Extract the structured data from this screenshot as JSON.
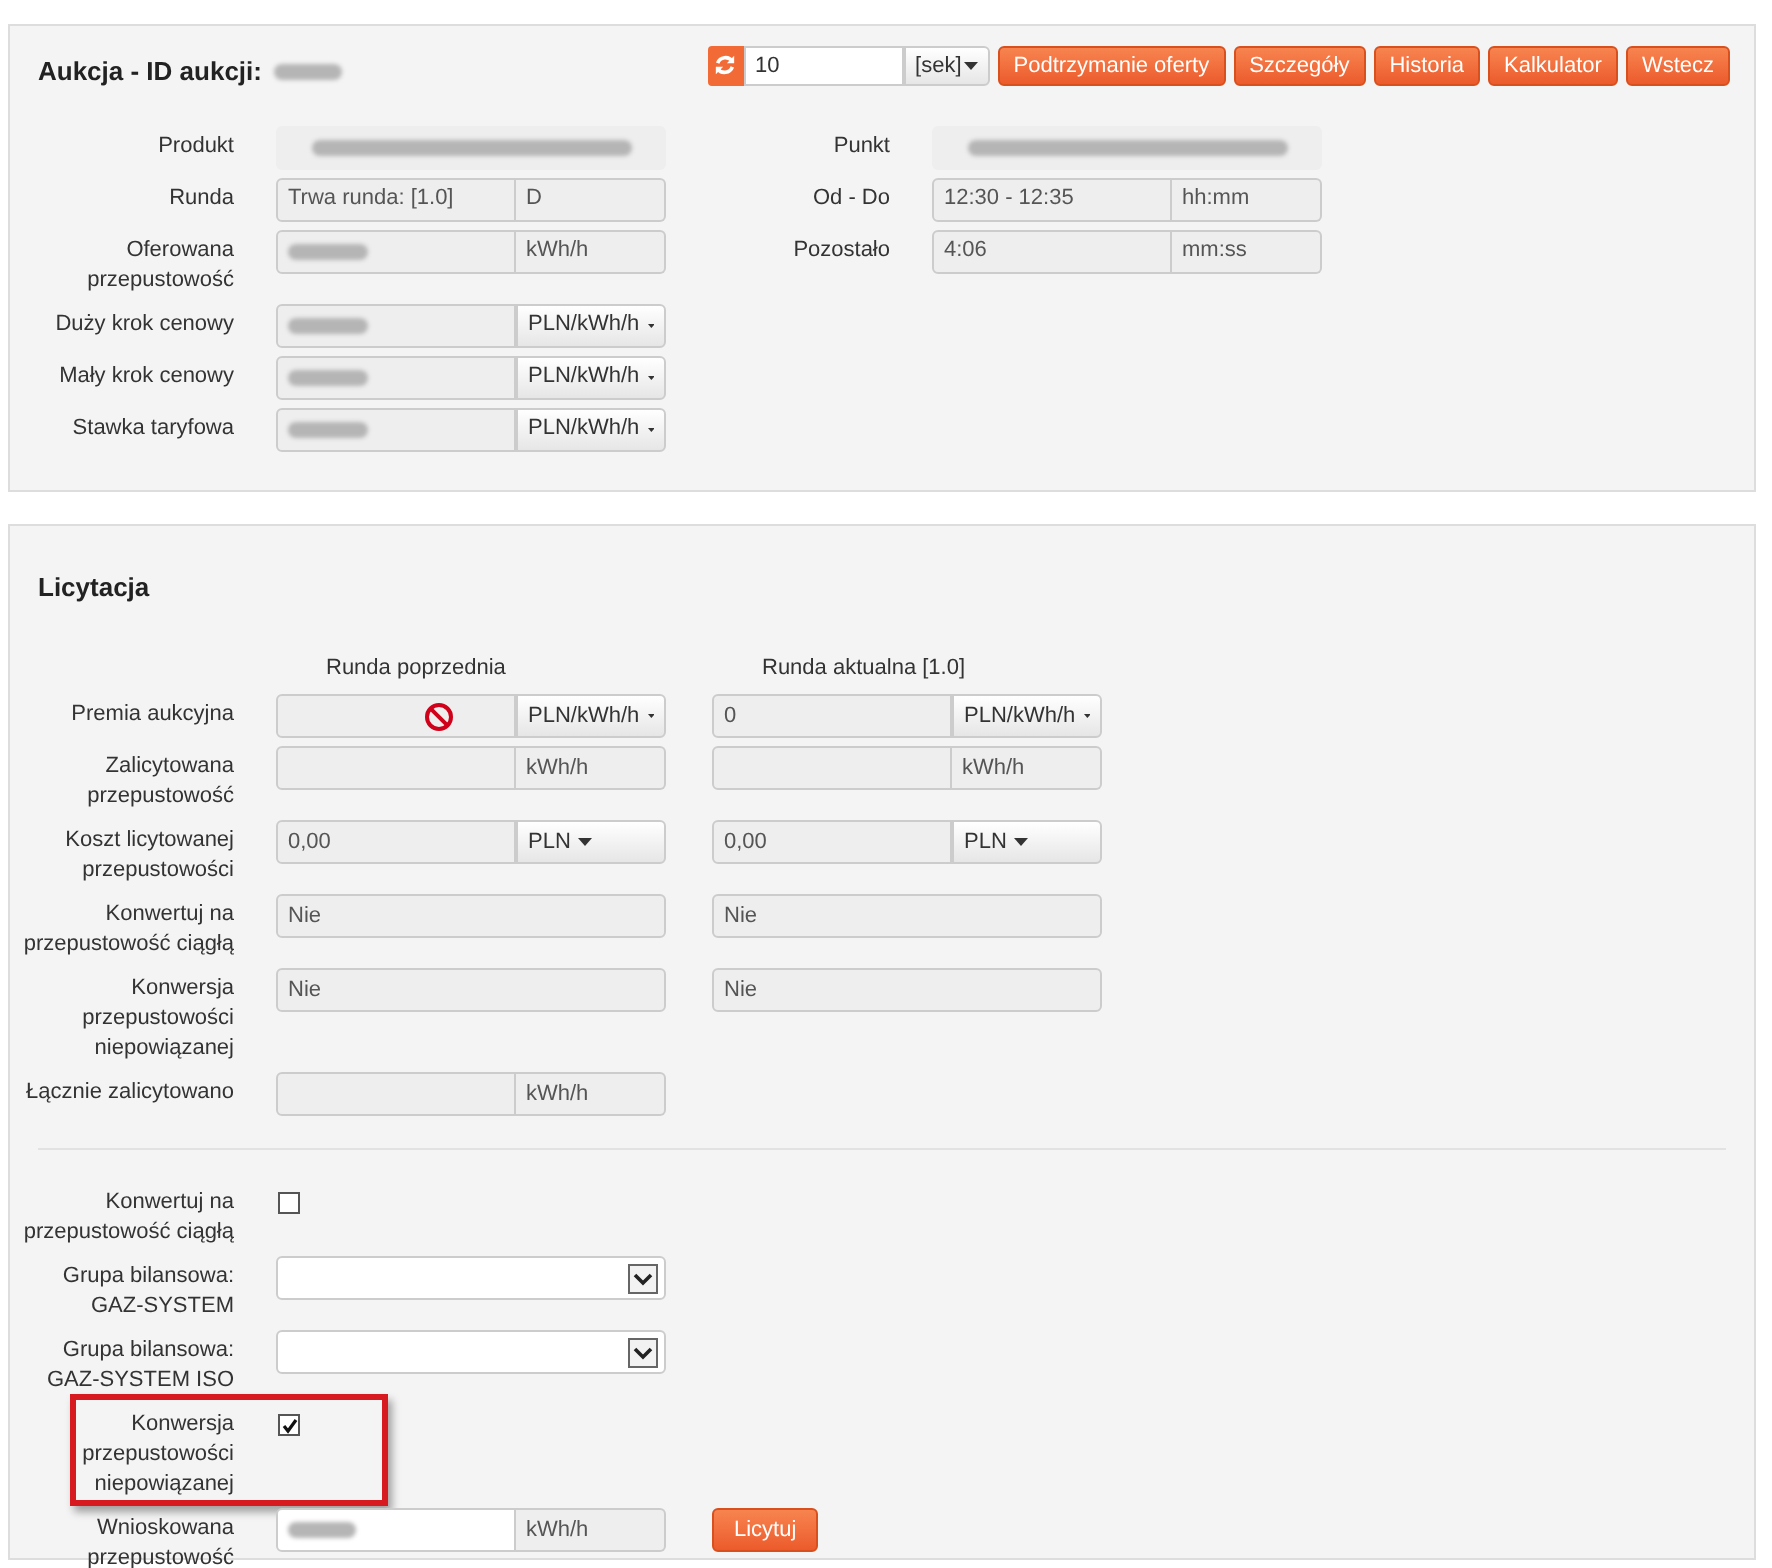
{
  "header": {
    "title": "Aukcja - ID aukcji:",
    "id_redacted": true
  },
  "refresh": {
    "value": "10",
    "unit": "[sek]"
  },
  "buttons": [
    "Podtrzymanie oferty",
    "Szczegóły",
    "Historia",
    "Kalkulator",
    "Wstecz"
  ],
  "left_fields": [
    {
      "label": "Produkt",
      "kind": "redacted"
    },
    {
      "label": "Runda",
      "kind": "pair",
      "value": "Trwa runda: [1.0]",
      "unit": "D",
      "unit_dropdown": false
    },
    {
      "label": "Oferowana przepustowość",
      "kind": "pair",
      "value_redacted": true,
      "unit": "kWh/h",
      "unit_dropdown": false
    },
    {
      "label": "Duży krok cenowy",
      "kind": "pair",
      "value_redacted": true,
      "unit": "PLN/kWh/h",
      "unit_dropdown": true
    },
    {
      "label": "Mały krok cenowy",
      "kind": "pair",
      "value_redacted": true,
      "unit": "PLN/kWh/h",
      "unit_dropdown": true
    },
    {
      "label": "Stawka taryfowa",
      "kind": "pair",
      "value_redacted": true,
      "unit": "PLN/kWh/h",
      "unit_dropdown": true
    }
  ],
  "right_fields": [
    {
      "label": "Punkt",
      "kind": "redacted"
    },
    {
      "label": "Od - Do",
      "kind": "pair",
      "value": "12:30 - 12:35",
      "unit": "hh:mm",
      "unit_dropdown": false
    },
    {
      "label": "Pozostało",
      "kind": "pair",
      "value": "4:06",
      "unit": "mm:ss",
      "unit_dropdown": false
    }
  ],
  "bidding": {
    "title": "Licytacja",
    "columns": [
      "Runda poprzednia",
      "Runda aktualna [1.0]"
    ],
    "rows": [
      {
        "label": "Premia aukcyjna",
        "cells": [
          {
            "kind": "pair",
            "blocked": true,
            "unit": "PLN/kWh/h",
            "unit_dropdown": true
          },
          {
            "kind": "pair",
            "value": "0",
            "unit": "PLN/kWh/h",
            "unit_dropdown": true
          }
        ]
      },
      {
        "label": "Zalicytowana przepustowość",
        "cells": [
          {
            "kind": "pair",
            "unit": "kWh/h",
            "unit_dropdown": false
          },
          {
            "kind": "pair",
            "unit": "kWh/h",
            "unit_dropdown": false
          }
        ]
      },
      {
        "label": "Koszt licytowanej przepustowości",
        "cells": [
          {
            "kind": "pair",
            "value": "0,00",
            "unit": "PLN",
            "unit_dropdown": true
          },
          {
            "kind": "pair",
            "value": "0,00",
            "unit": "PLN",
            "unit_dropdown": true
          }
        ]
      },
      {
        "label": "Konwertuj na przepustowość ciągłą",
        "cells": [
          {
            "kind": "text",
            "value": "Nie"
          },
          {
            "kind": "text",
            "value": "Nie"
          }
        ]
      },
      {
        "label": "Konwersja przepustowości niepowiązanej",
        "cells": [
          {
            "kind": "text",
            "value": "Nie"
          },
          {
            "kind": "text",
            "value": "Nie"
          }
        ]
      },
      {
        "label": "Łącznie zalicytowano",
        "cells": [
          {
            "kind": "pair",
            "unit": "kWh/h",
            "unit_dropdown": false
          }
        ]
      }
    ]
  },
  "form": [
    {
      "label": "Konwertuj na przepustowość ciągłą",
      "kind": "checkbox",
      "checked": false,
      "highlighted": false
    },
    {
      "label": "Grupa bilansowa: GAZ-SYSTEM",
      "kind": "select"
    },
    {
      "label": "Grupa bilansowa: GAZ-SYSTEM ISO",
      "kind": "select"
    },
    {
      "label": "Konwersja przepustowości niepowiązanej",
      "kind": "checkbox",
      "checked": true,
      "highlighted": true
    },
    {
      "label": "Wnioskowana przepustowość",
      "kind": "input",
      "value_redacted": true,
      "unit": "kWh/h",
      "button": "Licytuj"
    }
  ]
}
